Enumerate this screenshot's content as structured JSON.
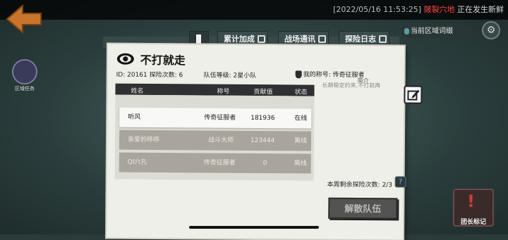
{
  "status_bar": {
    "timestamp": "[2022/05/16 11:53:25]",
    "place": "皴裂穴地",
    "event": "正在发生新鲜"
  },
  "region": {
    "label": "当前区域词缀"
  },
  "side": {
    "mission_label": "区域任务"
  },
  "tabs": [
    {
      "label": "累计加成"
    },
    {
      "label": "战场通讯"
    },
    {
      "label": "探险日志"
    }
  ],
  "team": {
    "name": "不打就走",
    "id_text": "ID: 20161  探险次数: 6",
    "tier_text": "队伍等级: 2星小队",
    "my_title": "我的称号: 传奇征服者",
    "intro_label": "简介",
    "intro_text": "长期稳定的来,不打就再"
  },
  "table": {
    "headers": {
      "name": "姓名",
      "title": "称号",
      "contribution": "贡献值",
      "status": "状态"
    },
    "rows": [
      {
        "name": "听风",
        "title": "传奇征服者",
        "contribution": "181936",
        "status": "在线"
      },
      {
        "name": "亲爱的哆哆",
        "title": "战斗大师",
        "contribution": "123444",
        "status": "离线"
      },
      {
        "name": "QI六孔",
        "title": "传奇征服者",
        "contribution": "0",
        "status": "离线"
      }
    ]
  },
  "attempts_text": "本周剩余探险次数: 2/3",
  "disband_label": "解散队伍",
  "leader_mark_label": "团长标记",
  "icons": [
    "back-arrow-icon",
    "pin-icon",
    "gear-icon",
    "mission-icon",
    "notebook-icon",
    "eye-icon",
    "shield-icon",
    "edit-icon",
    "help-icon",
    "exclamation-icon"
  ],
  "colors": {
    "panel": "#efefe9",
    "table_header": "#2f3031",
    "online_row": "#f8f8f6",
    "offline_row": "#a8a59c",
    "alert_red": "#ff4444",
    "back_orange": "#c8742a"
  }
}
